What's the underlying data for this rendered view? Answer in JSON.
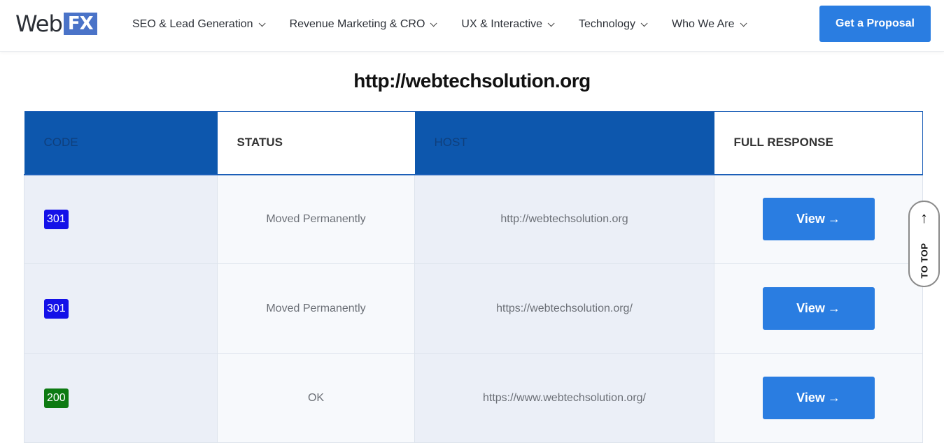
{
  "header": {
    "logo": {
      "part1": "Web",
      "part2": "FX"
    },
    "nav": [
      {
        "label": "SEO & Lead Generation"
      },
      {
        "label": "Revenue Marketing & CRO"
      },
      {
        "label": "UX & Interactive"
      },
      {
        "label": "Technology"
      },
      {
        "label": "Who We Are"
      }
    ],
    "cta_label": "Get a Proposal"
  },
  "main": {
    "title": "http://webtechsolution.org",
    "table": {
      "headers": [
        "CODE",
        "STATUS",
        "HOST",
        "FULL RESPONSE"
      ],
      "rows": [
        {
          "code": "301",
          "code_color": "#1411e8",
          "status": "Moved Permanently",
          "host": "http://webtechsolution.org",
          "action": "View"
        },
        {
          "code": "301",
          "code_color": "#1411e8",
          "status": "Moved Permanently",
          "host": "https://webtechsolution.org/",
          "action": "View"
        },
        {
          "code": "200",
          "code_color": "#0d7a12",
          "status": "OK",
          "host": "https://www.webtechsolution.org/",
          "action": "View"
        }
      ]
    }
  },
  "to_top": {
    "label": "TO TOP",
    "icon": "arrow-up-icon"
  },
  "colors": {
    "accent": "#2a7de1",
    "header_dark": "#0d57ad",
    "redirect_badge": "#1411e8",
    "ok_badge": "#0d7a12"
  }
}
